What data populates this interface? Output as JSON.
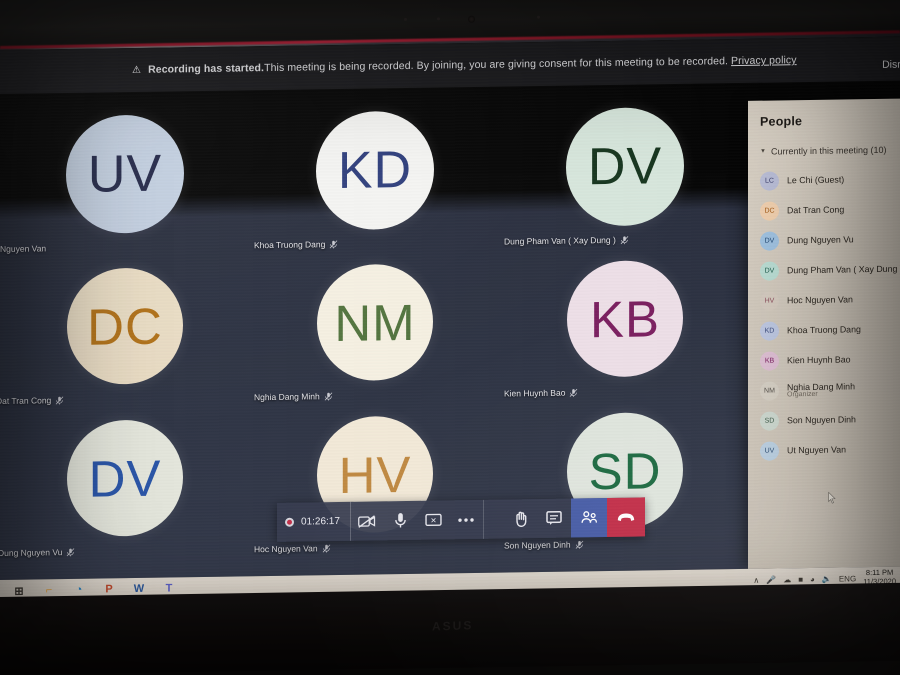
{
  "device": {
    "brand": "ASUS"
  },
  "banner": {
    "icon": "warning-icon",
    "bold_text": "Recording has started.",
    "text": " This meeting is being recorded. By joining, you are giving consent for this meeting to be recorded.",
    "link": "Privacy policy",
    "dismiss": "Dism"
  },
  "grid": {
    "participants": [
      {
        "initials": "UV",
        "name": "Nguyen Van",
        "muted": false,
        "bg": "#c3cfe0",
        "fg": "#252a4a",
        "name_align": "left"
      },
      {
        "initials": "KD",
        "name": "Khoa Truong Dang",
        "muted": true,
        "bg": "#f4f4f2",
        "fg": "#2f3f7c",
        "name_align": "left"
      },
      {
        "initials": "DV",
        "name": "Dung Pham Van ( Xay Dung )",
        "muted": true,
        "bg": "#d7e6dc",
        "fg": "#17361f",
        "name_align": "left"
      },
      {
        "initials": "DC",
        "name": "Dat Tran Cong",
        "muted": true,
        "bg": "#e9dcc4",
        "fg": "#b1721a",
        "name_align": "left"
      },
      {
        "initials": "NM",
        "name": "Nghia Dang Minh",
        "muted": true,
        "bg": "#f5f0e2",
        "fg": "#53743f",
        "name_align": "left"
      },
      {
        "initials": "KB",
        "name": "Kien Huynh Bao",
        "muted": true,
        "bg": "#eddfe7",
        "fg": "#7b2060",
        "name_align": "left"
      },
      {
        "initials": "DV",
        "name": "Dung Nguyen Vu",
        "muted": true,
        "bg": "#e4e6dc",
        "fg": "#2b56a8",
        "name_align": "left"
      },
      {
        "initials": "HV",
        "name": "Hoc Nguyen Van",
        "muted": true,
        "bg": "#f2e9d8",
        "fg": "#c08a42",
        "name_align": "left"
      },
      {
        "initials": "SD",
        "name": "Son Nguyen Dinh",
        "muted": true,
        "bg": "#dfe5dd",
        "fg": "#1f6b43",
        "name_align": "left"
      }
    ]
  },
  "controls": {
    "record_label": "record-indicator",
    "timer": "01:26:17",
    "buttons": [
      {
        "name": "camera-off-icon",
        "active": false
      },
      {
        "name": "microphone-icon",
        "active": false
      },
      {
        "name": "share-screen-stop-icon",
        "active": false
      },
      {
        "name": "more-options-icon",
        "active": false
      },
      {
        "name": "raise-hand-icon",
        "active": false
      },
      {
        "name": "chat-icon",
        "active": false
      },
      {
        "name": "people-icon",
        "active": true
      },
      {
        "name": "hangup-icon",
        "active": true
      }
    ],
    "accent_people": "#4a5fa8",
    "accent_hangup": "#c4314b",
    "accent_record": "#c4314b"
  },
  "people_panel": {
    "title": "People",
    "section_label": "Currently in this meeting (10)",
    "members": [
      {
        "initials": "LC",
        "name": "Le Chi (Guest)",
        "role": "",
        "bg": "#b9bdd6",
        "fg": "#3c3f6b"
      },
      {
        "initials": "DC",
        "name": "Dat Tran Cong",
        "role": "",
        "bg": "#f0cfae",
        "fg": "#a25b18"
      },
      {
        "initials": "DV",
        "name": "Dung Nguyen Vu",
        "role": "",
        "bg": "#9fc1e0",
        "fg": "#244a74"
      },
      {
        "initials": "DV",
        "name": "Dung Pham Van ( Xay Dung )",
        "role": "",
        "bg": "#b9dcd2",
        "fg": "#1f5c4c"
      },
      {
        "initials": "HV",
        "name": "Hoc Nguyen Van",
        "role": "",
        "bg": "#d3c9be",
        "fg": "#8b4f5c"
      },
      {
        "initials": "KD",
        "name": "Khoa Truong Dang",
        "role": "",
        "bg": "#bcc6e0",
        "fg": "#3b4a7c"
      },
      {
        "initials": "KB",
        "name": "Kien Huynh Bao",
        "role": "",
        "bg": "#ddbdd2",
        "fg": "#7b2060"
      },
      {
        "initials": "NM",
        "name": "Nghia Dang Minh",
        "role": "Organizer",
        "bg": "#d3cdc2",
        "fg": "#55504a"
      },
      {
        "initials": "SD",
        "name": "Son Nguyen Dinh",
        "role": "",
        "bg": "#cbd6cd",
        "fg": "#3e5a48"
      },
      {
        "initials": "UV",
        "name": "Ut Nguyen Van",
        "role": "",
        "bg": "#bacee0",
        "fg": "#2f4e72"
      }
    ]
  },
  "taskbar": {
    "items": [
      {
        "name": "start-button",
        "glyph": "⊞",
        "color": "#3a3630"
      },
      {
        "name": "file-explorer-icon",
        "glyph": "⌐",
        "color": "#e8a33d"
      },
      {
        "name": "microsoft-edge-icon",
        "glyph": "◔",
        "color": "#1f7fc4"
      },
      {
        "name": "powerpoint-icon",
        "glyph": "P",
        "color": "#c0482b"
      },
      {
        "name": "word-icon",
        "glyph": "W",
        "color": "#2b579a"
      },
      {
        "name": "microsoft-teams-icon",
        "glyph": "T",
        "color": "#5b5fc7"
      }
    ],
    "tray": {
      "chevron": "∧",
      "icons": [
        "microphone-tray-icon",
        "onedrive-tray-icon",
        "battery-tray-icon",
        "wifi-tray-icon",
        "volume-tray-icon"
      ],
      "language": "ENG",
      "time": "8:11 PM",
      "date": "11/3/2020"
    }
  }
}
